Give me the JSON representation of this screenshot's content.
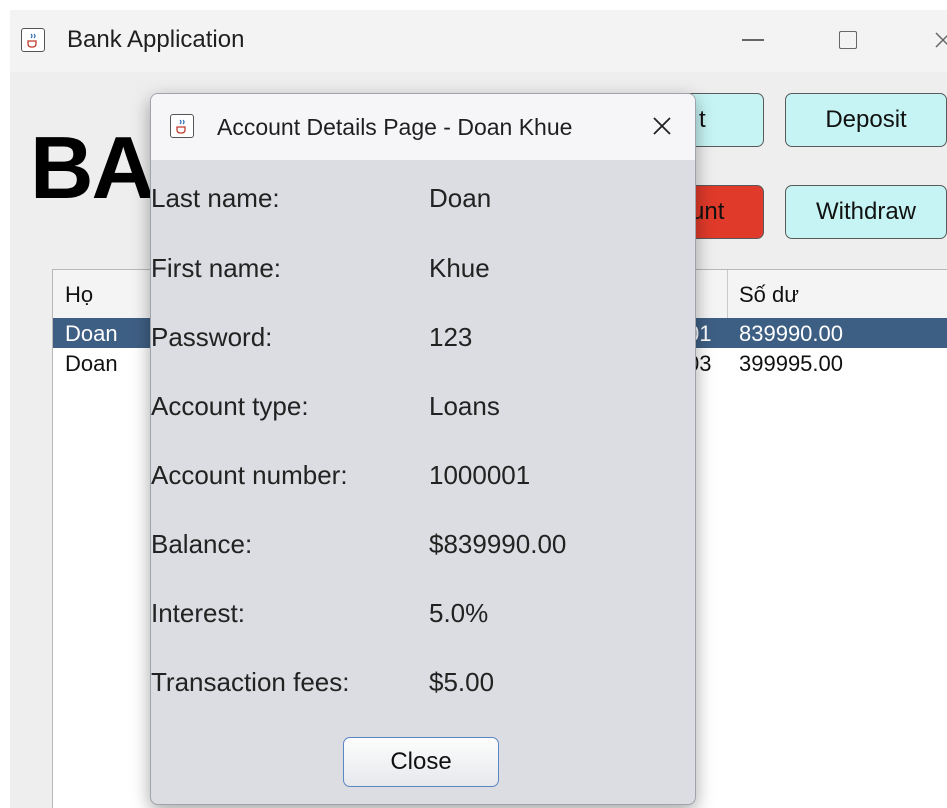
{
  "main_window": {
    "title": "Bank Application",
    "heading": "BA",
    "buttons": {
      "create_partial": "t",
      "deposit": "Deposit",
      "delete_partial": "unt",
      "withdraw": "Withdraw"
    },
    "table": {
      "headers": {
        "last_name": "Họ",
        "balance": "Số dư"
      },
      "rows": [
        {
          "last_name": "Doan",
          "account_suffix": "01",
          "balance": "839990.00",
          "selected": true
        },
        {
          "last_name": "Doan",
          "account_suffix": "03",
          "balance": "399995.00",
          "selected": false
        }
      ]
    }
  },
  "dialog": {
    "title": "Account Details Page - Doan Khue",
    "fields": [
      {
        "label": "Last name:",
        "value": "Doan"
      },
      {
        "label": "First name:",
        "value": "Khue"
      },
      {
        "label": "Password:",
        "value": "123"
      },
      {
        "label": "Account type:",
        "value": "Loans"
      },
      {
        "label": "Account number:",
        "value": "1000001"
      },
      {
        "label": "Balance:",
        "value": "$839990.00"
      },
      {
        "label": "Interest:",
        "value": "5.0%"
      },
      {
        "label": "Transaction fees:",
        "value": "$5.00"
      }
    ],
    "close_label": "Close"
  },
  "colors": {
    "action_button": "#c6f4f4",
    "delete_button": "#e03a2a",
    "selected_row": "#3e5f84",
    "dialog_background": "#dcdde2"
  },
  "icons": {
    "app_icon": "java-cup-icon",
    "minimize": "minimize-icon",
    "maximize": "maximize-icon",
    "close": "close-icon"
  }
}
